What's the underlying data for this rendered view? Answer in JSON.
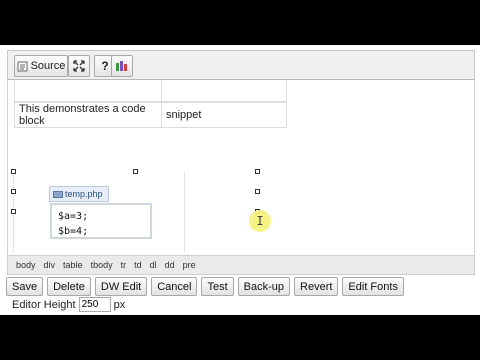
{
  "toolbar": {
    "source_label": "Source",
    "maximize_icon": "maximize-icon",
    "help_label": "?",
    "plugin_icon": "php-code-icon"
  },
  "editor": {
    "table_row": [
      "This demonstrates a code block",
      "snippet"
    ],
    "file_tab_label": "temp.php",
    "code_lines": [
      "$a=3;",
      "$b=4;"
    ]
  },
  "path": [
    "body",
    "div",
    "table",
    "tbody",
    "tr",
    "td",
    "dl",
    "dd",
    "pre"
  ],
  "actions": [
    "Save",
    "Delete",
    "DW Edit",
    "Cancel",
    "Test",
    "Back-up",
    "Revert",
    "Edit Fonts"
  ],
  "height": {
    "label": "Editor Height",
    "value": "250",
    "unit": "px"
  }
}
